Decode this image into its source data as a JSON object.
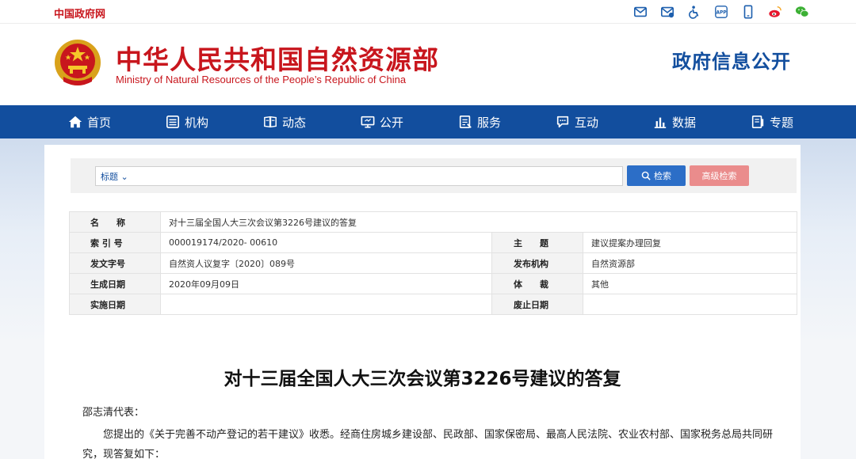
{
  "topbar": {
    "gov_link": "中国政府网",
    "icons": [
      "mail-icon",
      "subscribe-mail-icon",
      "accessibility-icon",
      "app-icon",
      "mobile-icon",
      "weibo-icon",
      "wechat-icon"
    ],
    "app_text": "APP"
  },
  "header": {
    "title_zh": "中华人民共和国自然资源部",
    "title_en": "Ministry of Natural Resources of the People’s Republic of China",
    "open_title": "政府信息公开"
  },
  "nav": {
    "items": [
      {
        "label": "首页",
        "icon": "home-icon"
      },
      {
        "label": "机构",
        "icon": "org-icon"
      },
      {
        "label": "动态",
        "icon": "news-icon"
      },
      {
        "label": "公开",
        "icon": "monitor-icon"
      },
      {
        "label": "服务",
        "icon": "service-icon"
      },
      {
        "label": "互动",
        "icon": "chat-icon"
      },
      {
        "label": "数据",
        "icon": "bar-chart-icon"
      },
      {
        "label": "专题",
        "icon": "topic-icon"
      }
    ]
  },
  "search": {
    "select_value": "标题",
    "input_value": "",
    "search_label": "检索",
    "advanced_label": "高级检索"
  },
  "meta": {
    "name_key": "名　　称",
    "name_value": "对十三届全国人大三次会议第3226号建议的答复",
    "rows": [
      {
        "k1": "索 引 号",
        "v1": "000019174/2020- 00610",
        "k2": "主　　题",
        "v2": "建议提案办理回复"
      },
      {
        "k1": "发文字号",
        "v1": "自然资人议复字〔2020〕089号",
        "k2": "发布机构",
        "v2": "自然资源部"
      },
      {
        "k1": "生成日期",
        "v1": "2020年09月09日",
        "k2": "体　　裁",
        "v2": "其他"
      },
      {
        "k1": "实施日期",
        "v1": "",
        "k2": "废止日期",
        "v2": ""
      }
    ]
  },
  "article": {
    "title": "对十三届全国人大三次会议第3226号建议的答复",
    "salutation": "邵志清代表：",
    "para1": "您提出的《关于完善不动产登记的若干建议》收悉。经商住房城乡建设部、民政部、国家保密局、最高人民法院、农业农村部、国家税务总局共同研究，现答复如下："
  },
  "colors": {
    "brand_red": "#c8161d",
    "nav_blue": "#124e9e",
    "search_blue": "#2c6ec7",
    "advanced_pink": "#ea8c8c"
  }
}
